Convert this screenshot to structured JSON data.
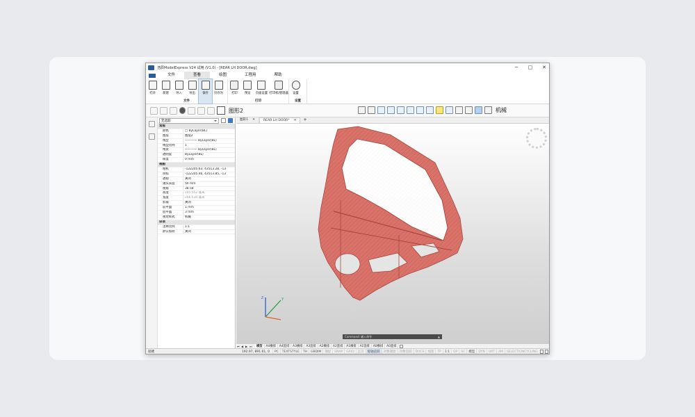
{
  "app": {
    "title": "浩辰ModelExpress V24 试用 (V1.0) - [REAR LH DOOR.dwg]",
    "window_controls": [
      "─",
      "□",
      "✕"
    ],
    "accent": "#2b5c9b"
  },
  "menu": {
    "items": [
      "文件",
      "查看",
      "绘图",
      "工程用",
      "帮助"
    ],
    "active_index": 1
  },
  "ribbon": {
    "file_group_label": "文件",
    "print_group_label": "打印",
    "settings_group_label": "设置",
    "file_buttons": [
      "打开",
      "新建",
      "导入",
      "导出",
      "保存",
      "另存为"
    ],
    "print_buttons": [
      "打印",
      "预览",
      "页面设置",
      "打印机/管理器"
    ],
    "settings_buttons": [
      "设置"
    ],
    "selected_button": "保存"
  },
  "toolbar2": {
    "layer_name": "图形2",
    "right_text": "机械"
  },
  "properties": {
    "selector_value": "无选取",
    "rows": [
      {
        "type": "cat",
        "k": "常规"
      },
      {
        "k": "颜色",
        "v": "□ ByLayer(BL)"
      },
      {
        "k": "图层",
        "v": "图层2"
      },
      {
        "k": "线型",
        "v": "———— ByLayer(BL)"
      },
      {
        "k": "线型比例",
        "v": "1"
      },
      {
        "k": "线宽",
        "v": "———— ByLayer(BL)"
      },
      {
        "k": "透明度",
        "v": "ByLayer(BL)"
      },
      {
        "k": "厚度",
        "v": "0 mm"
      },
      {
        "type": "cat",
        "k": "视图"
      },
      {
        "k": "相机",
        "v": "-122205.63, 43513.28, -13"
      },
      {
        "k": "目标",
        "v": "-122205.46, 43513.85, -13"
      },
      {
        "k": "透视",
        "v": "关闭"
      },
      {
        "k": "镜头长度",
        "v": "50 mm"
      },
      {
        "k": "视角",
        "v": "38.58"
      },
      {
        "k": "高度",
        "v": "145.552 毫米",
        "grey": true
      },
      {
        "k": "宽度",
        "v": "266.639 毫米",
        "grey": true
      },
      {
        "k": "剪裁",
        "v": "关闭"
      },
      {
        "k": "前平面",
        "v": "1 mm"
      },
      {
        "k": "后平面",
        "v": "3 mm"
      },
      {
        "k": "视觉样式",
        "v": "机械"
      },
      {
        "type": "cat",
        "k": "杂项"
      },
      {
        "k": "注释比例",
        "v": "1:1"
      },
      {
        "k": "默认照明",
        "v": "关闭"
      }
    ]
  },
  "tabs": {
    "items": [
      "图形1",
      "REAR LH DOOR*"
    ],
    "close_glyph": "✕",
    "active_index": 1,
    "add_glyph": "+"
  },
  "command": {
    "label": "Command: 输入命令",
    "arrow": "▲"
  },
  "layout_tabs": {
    "items": [
      "模型",
      "A4横排",
      "A4竖排",
      "A3横排",
      "A3竖排",
      "A2横排",
      "A2竖排",
      "A1横排",
      "A1竖排",
      "A0横排",
      "A0竖排"
    ],
    "active_index": 0,
    "nav": [
      "⏮",
      "◀",
      "▶",
      "⏭"
    ]
  },
  "status": {
    "left_text": "就绪",
    "coord": "192.97, 891.61, 0",
    "items": [
      {
        "t": "PC",
        "state": "on"
      },
      {
        "t": "TEXTSTYLE",
        "state": "on"
      },
      {
        "t": "TH",
        "state": "on"
      },
      {
        "t": "GBDIM",
        "state": "on"
      },
      {
        "t": "捕捉",
        "state": "off"
      },
      {
        "t": "SNAP",
        "state": "off"
      },
      {
        "t": "GRID",
        "state": "off"
      },
      {
        "t": "正交",
        "state": "off"
      },
      {
        "t": "极轴追踪",
        "state": "hl"
      },
      {
        "t": "对象捕捉",
        "state": "off"
      },
      {
        "t": "对象追踪",
        "state": "off"
      },
      {
        "t": "DUCS",
        "state": "off"
      },
      {
        "t": "线宽",
        "state": "off"
      },
      {
        "t": "TP",
        "state": "off"
      },
      {
        "t": "1:1",
        "state": "on"
      },
      {
        "t": "QP",
        "state": "off"
      },
      {
        "t": "SC",
        "state": "off"
      },
      {
        "t": "模型",
        "state": "on"
      },
      {
        "t": "DYN",
        "state": "off"
      },
      {
        "t": "LWT",
        "state": "off"
      },
      {
        "t": "AM",
        "state": "off"
      },
      {
        "t": "SELECTIONCYCLING",
        "state": "off"
      }
    ]
  },
  "model": {
    "color": "#d9736a",
    "axis_colors": {
      "x": "#e8602a",
      "y": "#1e9c3e",
      "z": "#2a4fd6"
    }
  }
}
